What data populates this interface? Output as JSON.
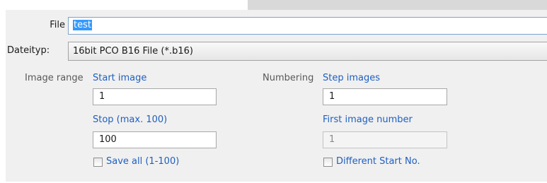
{
  "file": {
    "label": "File",
    "value": "test"
  },
  "filetype": {
    "label": "Dateityp:",
    "value": "16bit PCO B16 File (*.b16)"
  },
  "image_range": {
    "label": "Image range",
    "start_label": "Start image",
    "start_value": "1",
    "stop_label": "Stop (max. 100)",
    "stop_value": "100",
    "save_all_label": "Save all (1-100)",
    "save_all_checked": false
  },
  "numbering": {
    "label": "Numbering",
    "step_label": "Step images",
    "step_value": "1",
    "first_label": "First image number",
    "first_value": "1",
    "different_start_label": "Different Start No.",
    "different_start_checked": false
  },
  "colors": {
    "accent_text": "#1f5fbf",
    "selection": "#3399ff",
    "panel": "#f0f0f0"
  }
}
